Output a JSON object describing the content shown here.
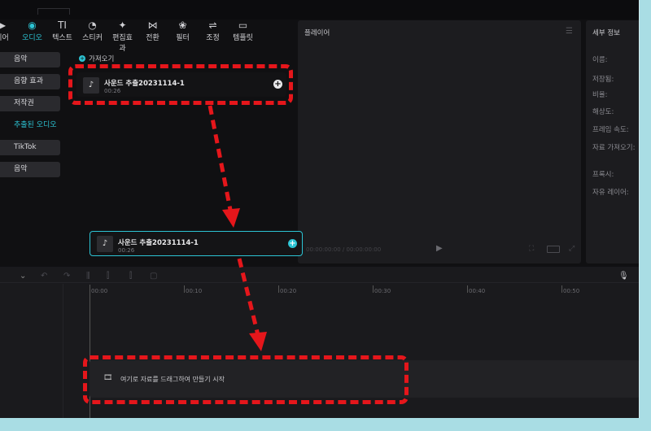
{
  "toolbar": {
    "tabs": [
      {
        "label": "디어",
        "icon": "media-icon",
        "glyph": "▶"
      },
      {
        "label": "오디오",
        "icon": "audio-icon",
        "glyph": "◉"
      },
      {
        "label": "텍스트",
        "icon": "text-icon",
        "glyph": "TI"
      },
      {
        "label": "스티커",
        "icon": "sticker-icon",
        "glyph": "◔"
      },
      {
        "label": "편집효과",
        "icon": "effects-icon",
        "glyph": "✦"
      },
      {
        "label": "전환",
        "icon": "transition-icon",
        "glyph": "⋈"
      },
      {
        "label": "필터",
        "icon": "filter-icon",
        "glyph": "❀"
      },
      {
        "label": "조정",
        "icon": "adjust-icon",
        "glyph": "⇌"
      },
      {
        "label": "템플릿",
        "icon": "template-icon",
        "glyph": "▭"
      }
    ],
    "active_index": 1
  },
  "sidebar": {
    "items": [
      "음악",
      "음향 효과",
      "저작권",
      "추출된 오디오",
      "TikTok",
      "음악"
    ],
    "active_index": 3
  },
  "media": {
    "import_label": "가져오기",
    "clip_title": "사운드 추출20231114-1",
    "clip_duration": "00:26"
  },
  "drag_ghost": {
    "title": "사운드 추출20231114-1",
    "duration": "00:26"
  },
  "player": {
    "title": "플레이어",
    "timecode": "00:00:00:00 / 00:00:00:00"
  },
  "details": {
    "title": "세부 정보",
    "labels": [
      "이름:",
      "저장됨:",
      "비율:",
      "해상도:",
      "프레임 속도:",
      "자료 가져오기:",
      "프록시:",
      "자유 레이어:"
    ]
  },
  "timeline": {
    "ruler": [
      "00:00",
      "00:10",
      "00:20",
      "00:30",
      "00:40",
      "00:50"
    ],
    "drop_hint": "여기로 자료를 드래그하여 만들기 시작"
  },
  "colors": {
    "accent": "#2cc4d4",
    "annotation_red": "#e5161b",
    "border_frame": "#a9dde4"
  }
}
